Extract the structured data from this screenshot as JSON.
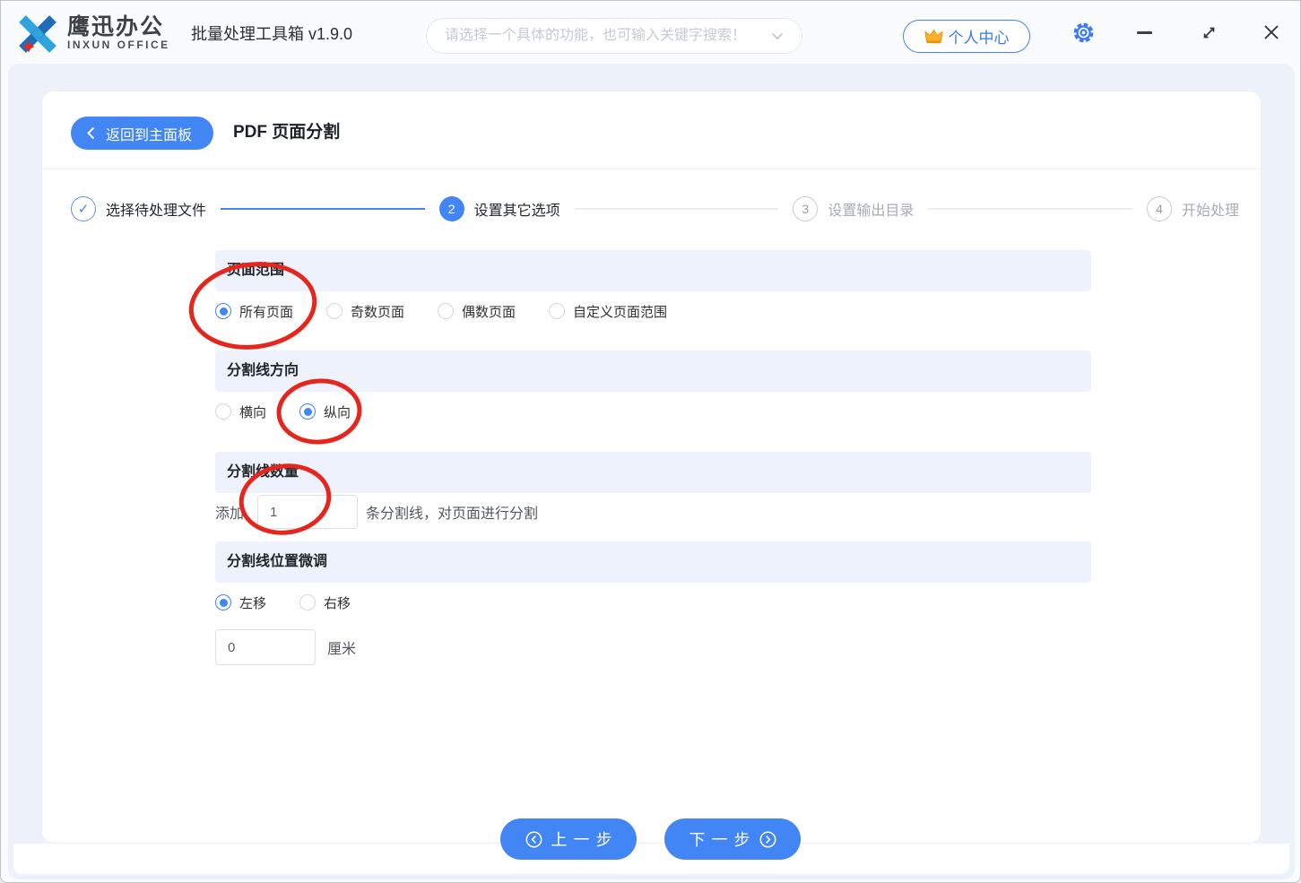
{
  "topbar": {
    "brand_cn": "鹰迅办公",
    "brand_en": "INXUN OFFICE",
    "app_title": "批量处理工具箱 v1.9.0",
    "search_placeholder": "请选择一个具体的功能，也可输入关键字搜索！",
    "user_center_label": "个人中心"
  },
  "page": {
    "back_label": "返回到主面板",
    "title": "PDF 页面分割"
  },
  "steps": [
    {
      "marker": "✓",
      "label": "选择待处理文件",
      "state": "done"
    },
    {
      "marker": "2",
      "label": "设置其它选项",
      "state": "active"
    },
    {
      "marker": "3",
      "label": "设置输出目录",
      "state": "pending"
    },
    {
      "marker": "4",
      "label": "开始处理",
      "state": "pending"
    }
  ],
  "sections": {
    "page_range": {
      "title": "页面范围",
      "options": [
        "所有页面",
        "奇数页面",
        "偶数页面",
        "自定义页面范围"
      ],
      "selected": "所有页面"
    },
    "direction": {
      "title": "分割线方向",
      "options": [
        "横向",
        "纵向"
      ],
      "selected": "纵向"
    },
    "count": {
      "title": "分割线数量",
      "prefix": "添加",
      "value": "1",
      "suffix": "条分割线，对页面进行分割"
    },
    "offset": {
      "title": "分割线位置微调",
      "options": [
        "左移",
        "右移"
      ],
      "selected": "左移",
      "value": "0",
      "unit": "厘米"
    }
  },
  "footer": {
    "prev_label": "上一步",
    "next_label": "下一步"
  },
  "colors": {
    "accent": "#4285f4",
    "annotation_red": "#e6251d",
    "section_bg": "#edf2fd"
  }
}
